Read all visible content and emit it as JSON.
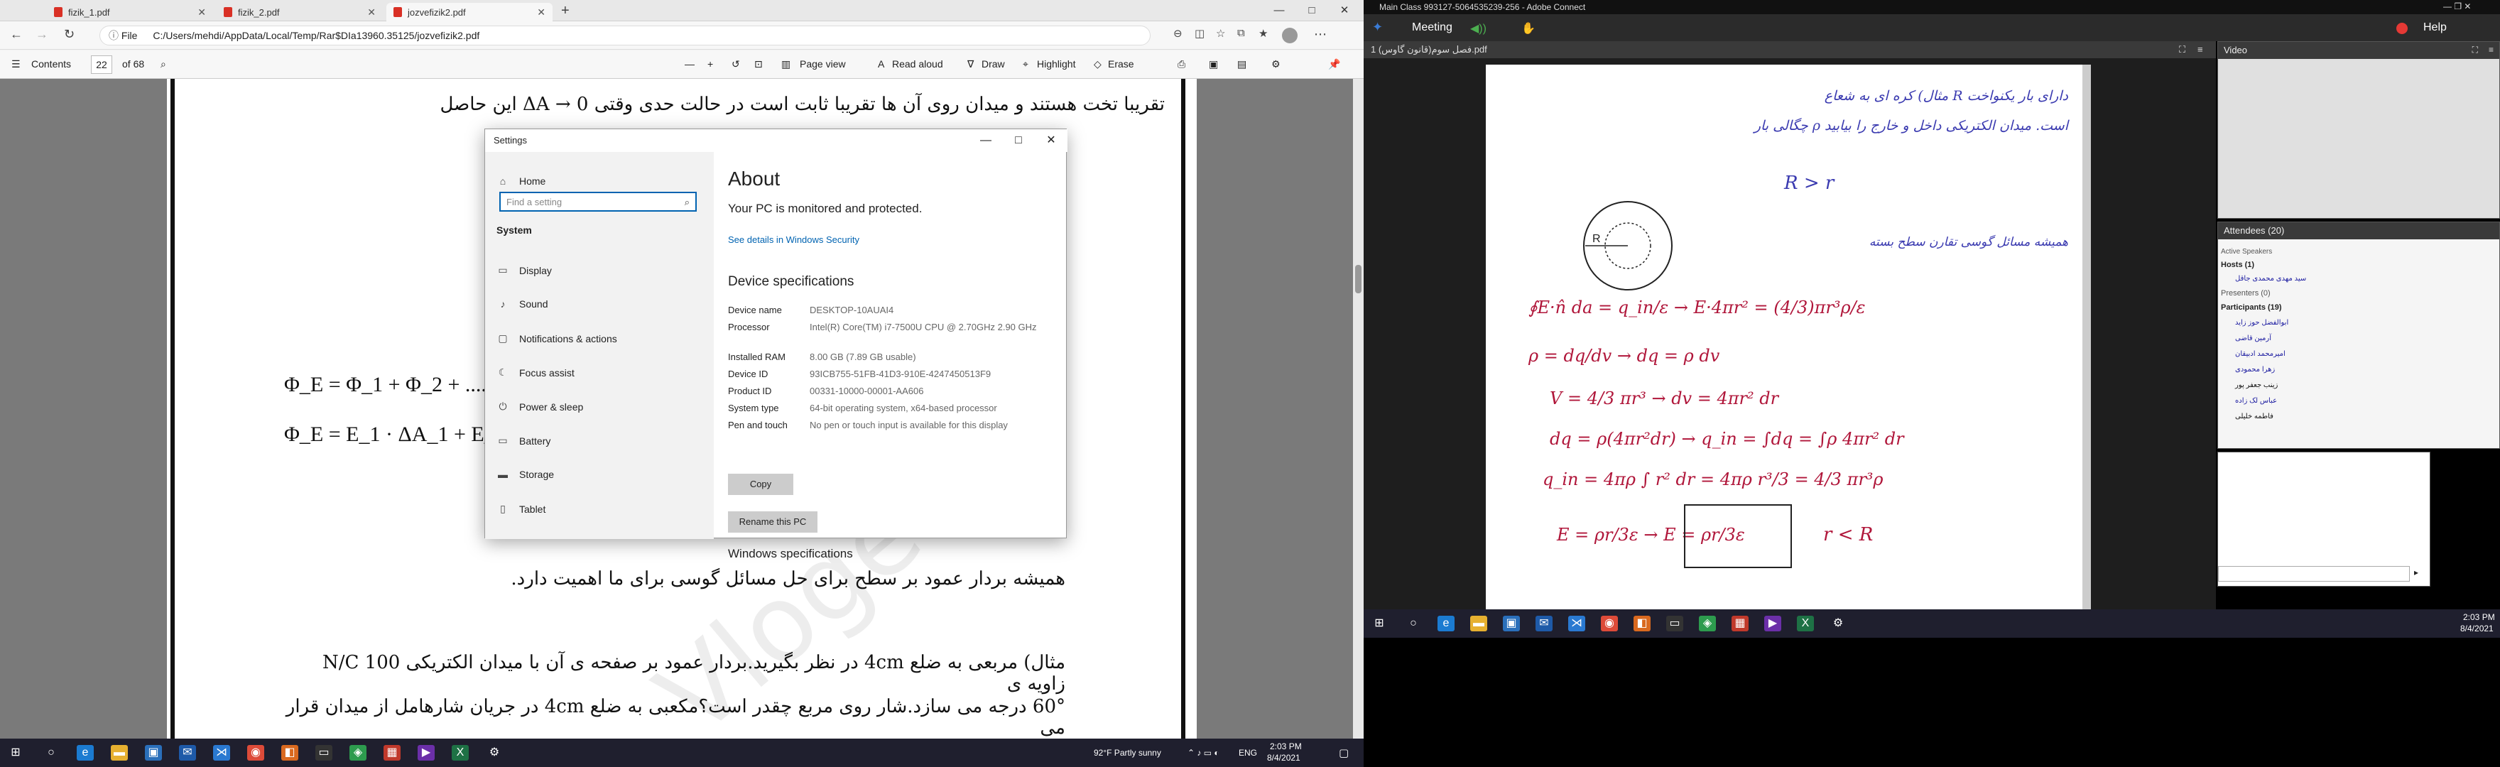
{
  "left": {
    "tabs": [
      {
        "label": "fizik_1.pdf"
      },
      {
        "label": "fizik_2.pdf"
      },
      {
        "label": "jozvefizik2.pdf"
      }
    ],
    "address": {
      "prefix": "File",
      "url": "C:/Users/mehdi/AppData/Local/Temp/Rar$DIa13960.35125/jozvefizik2.pdf"
    },
    "pdf_toolbar": {
      "contents": "Contents",
      "page": "22",
      "of": "of 68",
      "page_view": "Page view",
      "read_aloud": "Read aloud",
      "draw": "Draw",
      "highlight": "Highlight",
      "erase": "Erase"
    },
    "doc": {
      "line1": "تقریبا تخت هستند و میدان روی آن ها تقریبا ثابت است در حالت حدی وقتی 0 → ΔA این حاصل",
      "eq1": "Φ_E = Φ_1 + Φ_2 + ....",
      "eq2": "Φ_E = E_1 · ΔA_1 + E_2ΔA",
      "line2": "همیشه بردار عمود بر سطح برای حل مسائل گوسی برای ما اهمیت دارد.",
      "line3": "مثال) مربعی به ضلع 4cm در نظر بگیرید.بردار عمود بر صفحه ی آن با میدان الکتریکی 100 N/C زاویه ی",
      "line4": "60° درجه می سازد.شار روی مربع چقدر است؟مکعبی به ضلع 4cm در جریان شارهامل از میدان قرار می",
      "watermark": "Vloge"
    },
    "settings": {
      "title": "Settings",
      "home": "Home",
      "search_placeholder": "Find a setting",
      "section": "System",
      "menu": [
        "Display",
        "Sound",
        "Notifications & actions",
        "Focus assist",
        "Power & sleep",
        "Battery",
        "Storage",
        "Tablet"
      ],
      "about_title": "About",
      "monitored": "Your PC is monitored and protected.",
      "security_link": "See details in Windows Security",
      "device_specs": "Device specifications",
      "specs": [
        {
          "k": "Device name",
          "v": "DESKTOP-10AUAI4"
        },
        {
          "k": "Processor",
          "v": "Intel(R) Core(TM) i7-7500U CPU @ 2.70GHz   2.90 GHz"
        },
        {
          "k": "Installed RAM",
          "v": "8.00 GB (7.89 GB usable)"
        },
        {
          "k": "Device ID",
          "v": "93ICB755-51FB-41D3-910E-4247450513F9"
        },
        {
          "k": "Product ID",
          "v": "00331-10000-00001-AA606"
        },
        {
          "k": "System type",
          "v": "64-bit operating system, x64-based processor"
        },
        {
          "k": "Pen and touch",
          "v": "No pen or touch input is available for this display"
        }
      ],
      "copy": "Copy",
      "rename": "Rename this PC",
      "windows_specs": "Windows specifications"
    },
    "taskbar": {
      "weather": "92°F  Partly sunny",
      "lang": "ENG",
      "time": "2:03 PM",
      "date": "8/4/2021"
    }
  },
  "right": {
    "window_title": "Main Class 993127-5064535239-256 - Adobe Connect",
    "meeting": "Meeting",
    "help": "Help",
    "share_title": "1 فصل سوم(قانون گاوس).pdf",
    "video_title": "Video",
    "attendees": {
      "title": "Attendees",
      "count": "(20)",
      "active_speakers": "Active Speakers",
      "hosts": "Hosts (1)",
      "host_name": "سید مهدی محمدی جاقل",
      "presenters": "Presenters (0)",
      "participants": "Participants (19)",
      "names": [
        "ابوالفضل حوز زاید",
        "آرمین قاضی",
        "امیرمحمد ادبیقان",
        "زهرا محمودی",
        "زینب جعفر پور",
        "عباس لک زاده",
        "فاطمه خلیلی"
      ]
    },
    "whiteboard": {
      "l1": "مثال) کره ای به شعاع R دارای بار یکنواخت",
      "l2": "چگالی بار ρ است. میدان الکتریکی داخل و خارج را بیابید",
      "l3": "R > r",
      "l4": "همیشه مسائل گوسی تقارن سطح بسته",
      "eq1": "∮E·n̂ da = q_in/ε → E·4πr² = (4/3)πr³ρ/ε",
      "eq2": "ρ = dq/dv → dq = ρ dv",
      "eq3": "V = 4/3 πr³ → dv = 4πr² dr",
      "eq4": "dq = ρ(4πr²dr) → q_in = ∫dq = ∫ρ 4πr² dr",
      "eq5": "q_in = 4πρ ∫ r² dr = 4πρ r³/3 = 4/3 πr³ρ",
      "eq6": "E = ρr/3ε → E = ρr/3ε",
      "eq7": "r < R"
    },
    "taskbar": {
      "time": "2:03 PM",
      "date": "8/4/2021"
    }
  }
}
